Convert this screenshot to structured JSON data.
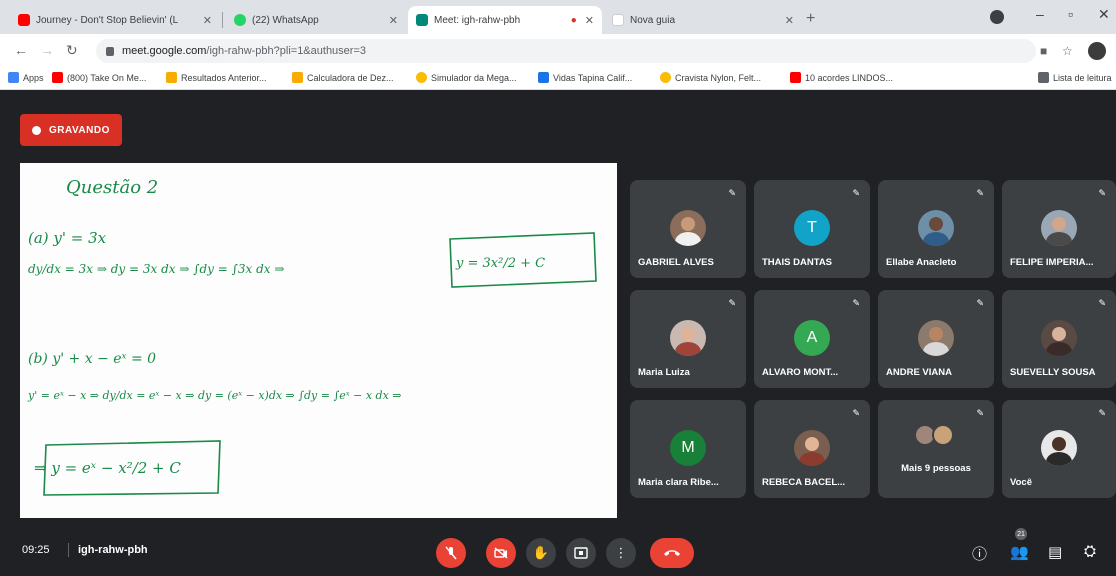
{
  "browser": {
    "tabs": [
      {
        "title": "Journey - Don't Stop Believin' (L",
        "favicon_color": "#ff0000",
        "close": "✕"
      },
      {
        "title": "(22) WhatsApp",
        "favicon_color": "#25d366",
        "close": "✕"
      },
      {
        "title": "Meet: igh-rahw-pbh",
        "favicon_color": "#00897b",
        "close": "✕",
        "recording_dot": "●"
      },
      {
        "title": "Nova guia",
        "favicon_color": "#ffffff",
        "close": "✕"
      }
    ],
    "new_tab": "+",
    "url_host": "meet.google.com",
    "url_path": "/igh-rahw-pbh?pli=1&authuser=3",
    "bookmarks": [
      {
        "label": "Apps",
        "color": "#4285f4"
      },
      {
        "label": "(800) Take On Me...",
        "color": "#ff0000"
      },
      {
        "label": "Resultados Anterior...",
        "color": "#f9ab00"
      },
      {
        "label": "Calculadora de Dez...",
        "color": "#f9ab00"
      },
      {
        "label": "Simulador da Mega...",
        "color": "#fbbc04"
      },
      {
        "label": "Vidas Tapina Calif...",
        "color": "#1a73e8"
      },
      {
        "label": "Cravista Nylon, Felt...",
        "color": "#fbbc04"
      },
      {
        "label": "10 acordes LINDOS...",
        "color": "#ff0000"
      },
      {
        "label": "Lista de leitura",
        "color": "#5f6368"
      }
    ]
  },
  "meet": {
    "recording_label": "GRAVANDO",
    "time": "09:25",
    "meeting_code": "igh-rahw-pbh",
    "participant_count": "21",
    "whiteboard": {
      "title": "Questão 2",
      "a_label": "(a) y' = 3x",
      "a_line": "dy/dx = 3x ⇒ dy = 3x dx ⇒ ∫dy = ∫3x dx ⇒",
      "a_result": "y = 3x²/2 + C",
      "b_label": "(b) y' + x − eˣ = 0",
      "b_line": "y' = eˣ − x ⇒ dy/dx = eˣ − x ⇒ dy = (eˣ − x)dx ⇒ ∫dy = ∫eˣ − x dx ⇒",
      "b_result": "⇒ y = eˣ − x²/2 + C"
    },
    "participants": [
      {
        "name": "GABRIEL ALVES",
        "type": "photo"
      },
      {
        "name": "THAIS DANTAS",
        "type": "initial",
        "initial": "T",
        "color": "#12a4c8"
      },
      {
        "name": "Ellabe Anacleto",
        "type": "photo"
      },
      {
        "name": "FELIPE IMPERIA...",
        "type": "photo"
      },
      {
        "name": "Maria Luiza",
        "type": "photo"
      },
      {
        "name": "ALVARO MONT...",
        "type": "initial",
        "initial": "A",
        "color": "#34a853"
      },
      {
        "name": "ANDRE VIANA",
        "type": "photo"
      },
      {
        "name": "SUEVELLY SOUSA",
        "type": "photo"
      },
      {
        "name": "Maria clara Ribe...",
        "type": "initial",
        "initial": "M",
        "color": "#188038"
      },
      {
        "name": "REBECA BACEL...",
        "type": "photo"
      },
      {
        "name": "Mais 9 pessoas",
        "type": "group"
      },
      {
        "name": "Você",
        "type": "photo"
      }
    ],
    "mic_icon": "✎"
  }
}
